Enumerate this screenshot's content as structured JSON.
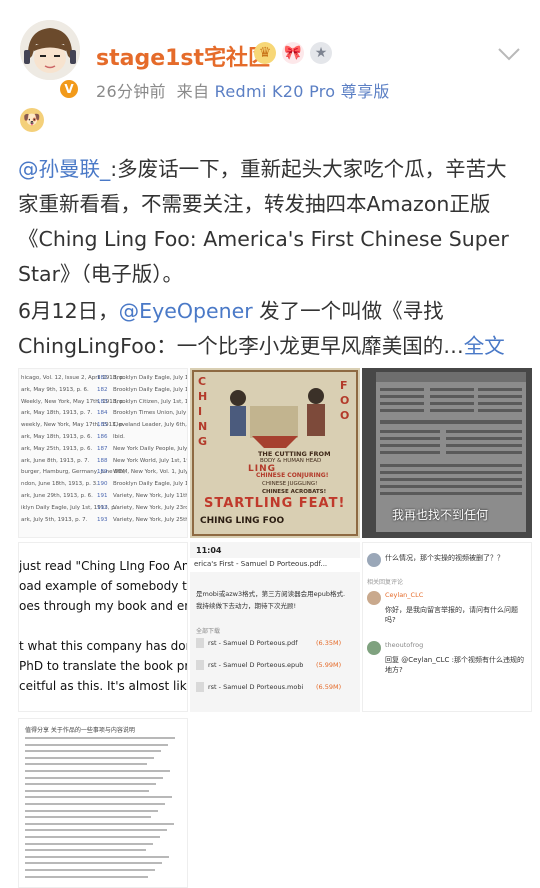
{
  "header": {
    "username": "stage1st宅社区",
    "time": "26分钟前",
    "from": "来自",
    "device": "Redmi K20 Pro 尊享版",
    "verified_badge": "V",
    "medals": [
      "crown-medal",
      "bow-medal",
      "silver-medal"
    ]
  },
  "post": {
    "mention": "@孙曼联_",
    "paragraph1": ":多废话一下，重新起头大家吃个瓜，辛苦大家重新看看，不需要关注，转发抽四本Amazon正版《Ching Ling Foo: America's First Chinese Super Star》（电子版）。",
    "paragraph2_prefix": "6月12日，",
    "paragraph2_mention": "@EyeOpener",
    "paragraph2_text": " 发了一个叫做《寻找ChingLingFoo：一个比李小龙更早风靡美国的…",
    "full_text_link": "全文"
  },
  "images": {
    "img1": {
      "lines": [
        "hicago, Vol. 12, Issue 2, April 1913, p.",
        "ark, May 9th, 1913, p. 6.",
        "Weekly, New York, May 17th, 1913, p.",
        "ark, May 18th, 1913, p. 7.",
        "weekly, New York, May 17th, 1913, p.",
        "ark, May 18th, 1913, p. 6.",
        "ark, May 25th, 1913, p. 6.",
        "ark, June 8th, 1913, p. 7.",
        "burger, Hamburg, Germany, June 6th,",
        "ndon, June 18th, 1913, p. 3.",
        "ark, June 29th, 1913, p. 6.",
        "iklyn Daily Eagle, July 1st, 1913, p.",
        "ark, July 5th, 1913, p. 7."
      ],
      "notes": [
        "181",
        "182",
        "183",
        "184",
        "185",
        "186",
        "187",
        "188",
        "189",
        "190",
        "191",
        "192",
        "193"
      ],
      "refs": [
        "Brooklyn Daily Eagle, July 1st",
        "Brooklyn Daily Eagle, July 1st",
        "Brooklyn Citizen, July 1st, 1913",
        "Brooklyn Times Union, July 2nd",
        "Cleveland Leader, July 6th, 1913",
        "Ibid.",
        "New York Daily People, July 6th",
        "New York World, July 1st, 1913",
        "WDM, New York, Vol. 1, July 7",
        "Brooklyn Daily Eagle, July 1st",
        "Variety, New York, July 11th",
        "Variety, New York, July 23rd",
        "Variety, New York, July 25th"
      ]
    },
    "img2": {
      "title_words": [
        "CHING",
        "LING",
        "FOO"
      ],
      "caption1": "THE CUTTING FROM",
      "caption2": "BODY & HUMAN HEAD",
      "caption3": "CHINESE CONJURING!",
      "caption4": "CHINESE JUGGLING!",
      "caption5": "CHINESE ACROBATS!",
      "feat": "STARTLING FEAT!",
      "bottom": "CHING LING FOO"
    },
    "img3": {
      "subtitle": "我再也找不到任何"
    },
    "img4": {
      "lines": [
        "just read \"Ching LIng Foo America",
        "oad example of somebody taking c",
        "oes through my book and endnote",
        "",
        "t what this company has done.",
        "PhD to translate the book properly",
        "ceitful as this. It's almost like what"
      ]
    },
    "img5": {
      "time": "11:04",
      "file_header": "erica's First - Samuel D Porteous.pdf...",
      "text1": "是mobi或azw3格式，第三方阅读器会用epub格式.",
      "text2": "我持续做下去动力，期待下次光顾!",
      "shop_label": "全部下载",
      "files": [
        "rst - Samuel D Porteous.pdf",
        "rst - Samuel D Porteous.epub",
        "rst - Samuel D Porteous.mobi"
      ],
      "sizes": [
        "(6.35M)",
        "(5.99M)",
        "(6.59M)"
      ]
    },
    "img6": {
      "q1": "什么情况，那个实操的视频被删了？？",
      "section": "相关回复评论",
      "user1": "Ceylan_CLC",
      "q2": "你好，是我向留言举报的，请问有什么问题吗?",
      "user2": "theoutofrog",
      "q3": "回复 @Ceylan_CLC :那个视频有什么违规的地方?"
    },
    "img7": {
      "title": "值得分享 关于作品的一些事项与内容说明"
    }
  },
  "colors": {
    "accent": "#e56b2a",
    "link": "#4a79c7",
    "meta": "#8a8a8a"
  }
}
